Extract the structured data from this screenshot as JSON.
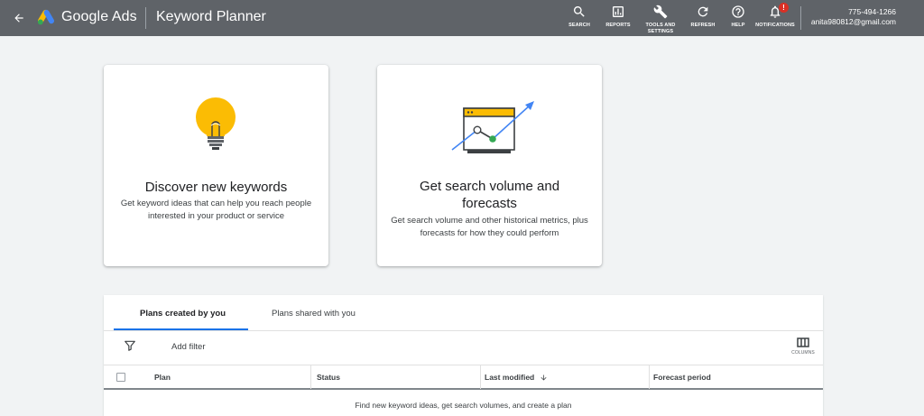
{
  "header": {
    "brand": "Google Ads",
    "page_name": "Keyword Planner",
    "tools": [
      {
        "label": "SEARCH",
        "icon": "search-icon"
      },
      {
        "label": "REPORTS",
        "icon": "reports-icon"
      },
      {
        "label": "TOOLS AND SETTINGS",
        "icon": "wrench-icon"
      },
      {
        "label": "REFRESH",
        "icon": "refresh-icon"
      },
      {
        "label": "HELP",
        "icon": "help-icon"
      },
      {
        "label": "NOTIFICATIONS",
        "icon": "bell-icon",
        "badge": "!"
      }
    ],
    "account": {
      "phone": "775-494-1266",
      "email": "anita980812@gmail.com"
    }
  },
  "cards": {
    "discover": {
      "title": "Discover new keywords",
      "description": "Get keyword ideas that can help you reach people interested in your product or service"
    },
    "forecast": {
      "title": "Get search volume and forecasts",
      "description": "Get search volume and other historical metrics, plus forecasts for how they could perform"
    }
  },
  "plans": {
    "tabs": [
      {
        "label": "Plans created by you",
        "active": true
      },
      {
        "label": "Plans shared with you",
        "active": false
      }
    ],
    "add_filter": "Add filter",
    "columns_label": "COLUMNS",
    "table_headers": [
      "Plan",
      "Status",
      "Last modified",
      "Forecast period"
    ],
    "empty_message": "Find new keyword ideas, get search volumes, and create a plan"
  },
  "colors": {
    "header_bg": "#5f6368",
    "accent": "#1a73e8",
    "bulb": "#fbbc04",
    "alert": "#d93025",
    "green": "#34a853"
  }
}
